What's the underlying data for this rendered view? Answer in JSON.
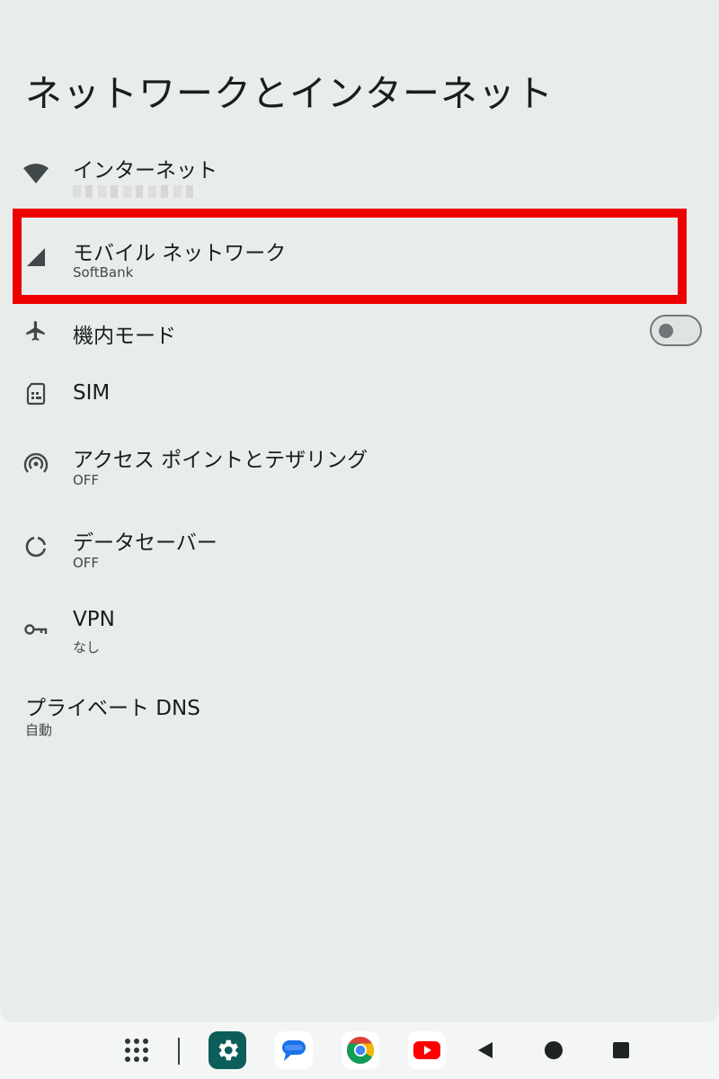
{
  "page": {
    "title": "ネットワークとインターネット"
  },
  "items": [
    {
      "id": "internet",
      "title": "インターネット",
      "summary": "",
      "icon": "wifi-icon"
    },
    {
      "id": "mobile-network",
      "title": "モバイル ネットワーク",
      "summary": "SoftBank",
      "icon": "cell-signal-icon"
    },
    {
      "id": "airplane-mode",
      "title": "機内モード",
      "icon": "airplane-icon",
      "toggle_on": false
    },
    {
      "id": "sim",
      "title": "SIM",
      "icon": "sim-card-icon"
    },
    {
      "id": "hotspot",
      "title": "アクセス ポイントとテザリング",
      "summary": "OFF",
      "icon": "hotspot-icon"
    },
    {
      "id": "data-saver",
      "title": "データセーバー",
      "summary": "OFF",
      "icon": "data-saver-icon"
    },
    {
      "id": "vpn",
      "title": "VPN",
      "summary": "なし",
      "icon": "vpn-key-icon"
    },
    {
      "id": "private-dns",
      "title": "プライベート DNS",
      "summary": "自動"
    }
  ],
  "highlight": {
    "color": "#ee0000"
  },
  "colors": {
    "background": "#e8edeb",
    "text": "#1b1c1c",
    "secondary_text": "#43474a",
    "icon": "#414849"
  },
  "taskbar": {
    "icons": [
      "app-drawer-icon",
      "settings-app-icon",
      "messages-app-icon",
      "chrome-app-icon",
      "youtube-app-icon",
      "back-icon",
      "home-icon",
      "recents-icon"
    ]
  }
}
